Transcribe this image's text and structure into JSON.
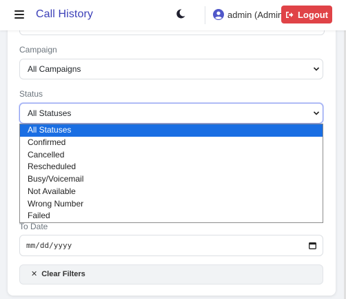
{
  "header": {
    "title": "Call History",
    "user_label": "admin (Admin)",
    "logout_label": "Logout",
    "menu_icon": "hamburger-icon",
    "theme_icon": "moon-icon",
    "user_icon": "user-circle-icon",
    "logout_icon": "sign-out-icon"
  },
  "filters": {
    "campaign_label": "Campaign",
    "campaign_value": "All Campaigns",
    "status_label": "Status",
    "status_value": "All Statuses",
    "status_options": [
      "All Statuses",
      "Confirmed",
      "Cancelled",
      "Rescheduled",
      "Busy/Voicemail",
      "Not Available",
      "Wrong Number",
      "Failed"
    ],
    "to_date_label": "To Date",
    "to_date_placeholder": "mm/dd/yyyy",
    "clear_label": "Clear Filters",
    "clear_icon": "x-icon"
  },
  "colors": {
    "brand": "#3b3fb8",
    "logout": "#e04347",
    "selected_option": "#1a6ee3"
  }
}
